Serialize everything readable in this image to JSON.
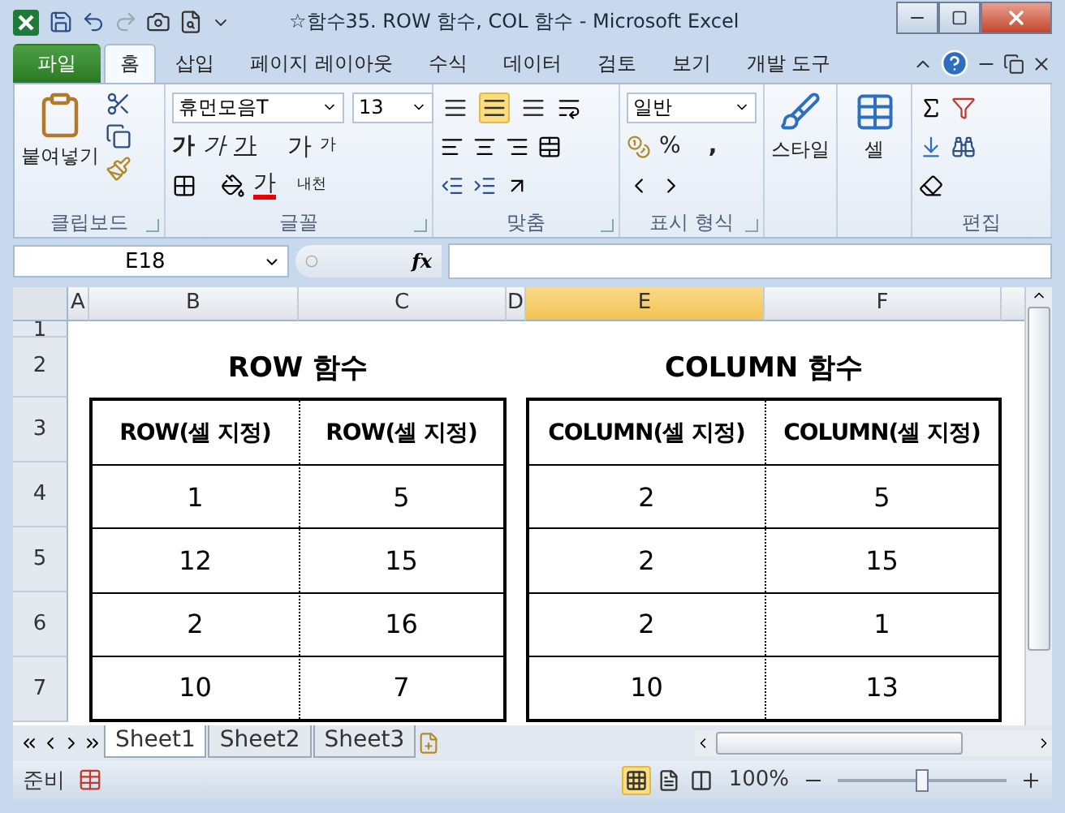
{
  "window": {
    "title": "☆함수35. ROW 함수, COL 함수  -  Microsoft Excel"
  },
  "ribbon_tabs": [
    {
      "label": "파일",
      "kind": "file",
      "selected": false
    },
    {
      "label": "홈",
      "kind": "tab",
      "selected": true
    },
    {
      "label": "삽입",
      "kind": "tab",
      "selected": false
    },
    {
      "label": "페이지 레이아웃",
      "kind": "tab",
      "selected": false
    },
    {
      "label": "수식",
      "kind": "tab",
      "selected": false
    },
    {
      "label": "데이터",
      "kind": "tab",
      "selected": false
    },
    {
      "label": "검토",
      "kind": "tab",
      "selected": false
    },
    {
      "label": "보기",
      "kind": "tab",
      "selected": false
    },
    {
      "label": "개발 도구",
      "kind": "tab",
      "selected": false
    }
  ],
  "ribbon_groups": [
    {
      "kind": "clipboard",
      "label": "클립보드",
      "paste": "붙여넣기"
    },
    {
      "kind": "font",
      "label": "글꼴",
      "font_name": "휴먼모음T",
      "font_size": "13",
      "bold": "가",
      "italic": "가",
      "underline": "가",
      "grow": "가",
      "shrink": "가",
      "font_color": "가",
      "phonetic": "내천"
    },
    {
      "kind": "alignment",
      "label": "맞춤",
      "vertical_align": [
        {
          "selected": false
        },
        {
          "selected": true
        },
        {
          "selected": false
        }
      ]
    },
    {
      "kind": "number",
      "label": "표시 형식",
      "format": "일반",
      "percent": "%",
      "comma": ","
    },
    {
      "kind": "styles",
      "button": "스타일"
    },
    {
      "kind": "cells",
      "button": "셀"
    },
    {
      "kind": "editing",
      "label": "편집"
    }
  ],
  "formula_bar": {
    "name_box": "E18",
    "fx": "fx"
  },
  "columns": [
    {
      "label": "A",
      "selected": false
    },
    {
      "label": "B",
      "selected": false
    },
    {
      "label": "C",
      "selected": false
    },
    {
      "label": "D",
      "selected": false
    },
    {
      "label": "E",
      "selected": true
    },
    {
      "label": "F",
      "selected": false
    }
  ],
  "rows": [
    "1",
    "2",
    "3",
    "4",
    "5",
    "6",
    "7"
  ],
  "tables": [
    {
      "title": "ROW 함수",
      "headers": [
        "ROW(셀 지정)",
        "ROW(셀 지정)"
      ],
      "rows": [
        [
          "1",
          "5"
        ],
        [
          "12",
          "15"
        ],
        [
          "2",
          "16"
        ],
        [
          "10",
          "7"
        ]
      ]
    },
    {
      "title": "COLUMN 함수",
      "headers": [
        "COLUMN(셀 지정)",
        "COLUMN(셀 지정)"
      ],
      "rows": [
        [
          "2",
          "5"
        ],
        [
          "2",
          "15"
        ],
        [
          "2",
          "1"
        ],
        [
          "10",
          "13"
        ]
      ]
    }
  ],
  "sheet_tabs": [
    {
      "label": "Sheet1",
      "selected": true
    },
    {
      "label": "Sheet2",
      "selected": false
    },
    {
      "label": "Sheet3",
      "selected": false
    }
  ],
  "status_bar": {
    "status": "준비",
    "views": [
      {
        "selected": true
      },
      {
        "selected": false
      },
      {
        "selected": false
      }
    ],
    "zoom": "100%",
    "zoom_slider": {
      "level": 0.5
    }
  }
}
